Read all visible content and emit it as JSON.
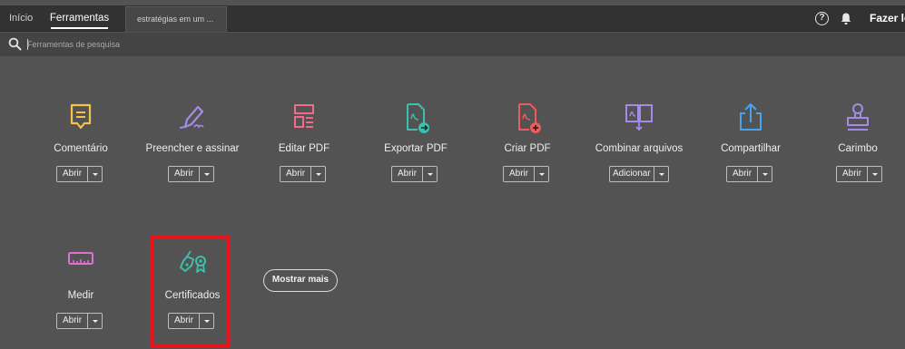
{
  "nav": {
    "home_label": "Início",
    "tools_label": "Ferramentas",
    "document_tab_label": "estratégias em um ...",
    "help_icon": "help-circle-icon",
    "help_glyph": "?",
    "notifications_icon": "bell-icon",
    "login_label": "Fazer lo"
  },
  "search": {
    "placeholder": "Ferramentas de pesquisa",
    "icon": "search-icon"
  },
  "tools": [
    {
      "label": "Comentário",
      "action": "Abrir",
      "icon": "comment-icon",
      "color": "#f5c24b"
    },
    {
      "label": "Preencher e assinar",
      "action": "Abrir",
      "icon": "fill-sign-pen-icon",
      "color": "#a48be7"
    },
    {
      "label": "Editar PDF",
      "action": "Abrir",
      "icon": "edit-pdf-icon",
      "color": "#ef6a8c"
    },
    {
      "label": "Exportar PDF",
      "action": "Abrir",
      "icon": "export-pdf-icon",
      "color": "#3cc0b0"
    },
    {
      "label": "Criar PDF",
      "action": "Abrir",
      "icon": "create-pdf-icon",
      "color": "#ef5a5a"
    },
    {
      "label": "Combinar arquivos",
      "action": "Adicionar",
      "icon": "combine-files-icon",
      "color": "#a48be7"
    },
    {
      "label": "Compartilhar",
      "action": "Abrir",
      "icon": "share-icon",
      "color": "#4aa3f0"
    },
    {
      "label": "Carimbo",
      "action": "Abrir",
      "icon": "stamp-icon",
      "color": "#a48be7"
    },
    {
      "label": "Medir",
      "action": "Abrir",
      "icon": "ruler-icon",
      "color": "#e06fd3"
    },
    {
      "label": "Certificados",
      "action": "Abrir",
      "icon": "certificate-pen-icon",
      "color": "#3cc0b0"
    }
  ],
  "show_more_label": "Mostrar mais",
  "colors": {
    "background": "#535353",
    "topbar": "#323232",
    "highlight": "#e8131b"
  }
}
